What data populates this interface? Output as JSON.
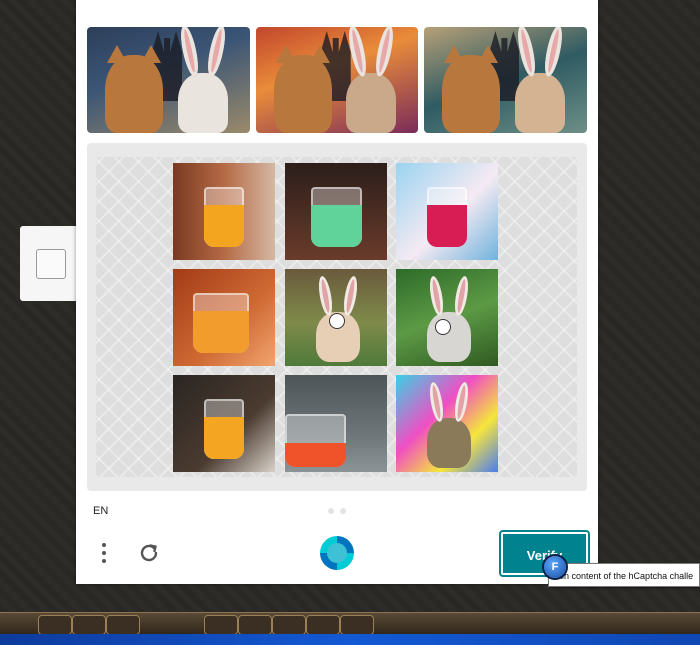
{
  "checkbox_widget": {},
  "challenge": {
    "example_images": [
      {
        "name": "example-cat-bunny-1"
      },
      {
        "name": "example-cat-bunny-2"
      },
      {
        "name": "example-cat-bunny-3"
      }
    ],
    "tiles": [
      {
        "content": "orange-juice-glass",
        "selected": false
      },
      {
        "content": "green-drink-glass",
        "selected": false
      },
      {
        "content": "red-drink-glass",
        "selected": false
      },
      {
        "content": "orange-drink-glass",
        "selected": false
      },
      {
        "content": "bunny",
        "selected": true
      },
      {
        "content": "bunny",
        "selected": true
      },
      {
        "content": "orange-juice-glass",
        "selected": false
      },
      {
        "content": "orange-drink-glass",
        "selected": false
      },
      {
        "content": "bunny-colorful",
        "selected": false
      }
    ]
  },
  "footer": {
    "language": "EN",
    "verify_label": "Verify"
  },
  "tooltip": {
    "text": "ain content of the hCaptcha challe"
  },
  "extension_icon": {
    "letter": "F"
  },
  "colors": {
    "accent": "#00838f",
    "panel_bg": "#ffffff",
    "taskbar": "#1359d4"
  }
}
